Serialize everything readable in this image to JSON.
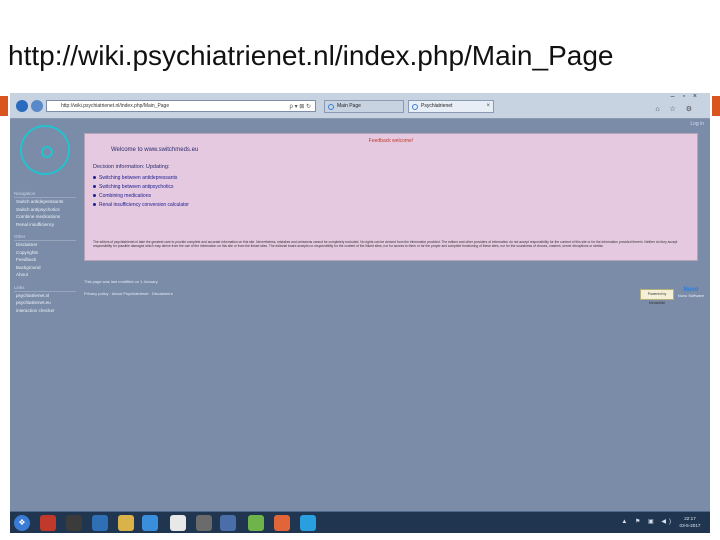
{
  "slide": {
    "title": "http://wiki.psychiatrienet.nl/index.php/Main_Page"
  },
  "browser": {
    "address": "http://wiki.psychiatrienet.nl/index.php/Main_Page",
    "address_controls": "ρ ▾ ⊠ ↻",
    "tabs": [
      {
        "label": "Main Page"
      },
      {
        "label": "Psychiatrienet"
      }
    ],
    "tab_close": "×",
    "window_controls": "– ▫ ×",
    "toolbar_icons": "⌂ ☆ ⚙",
    "login": "Log in"
  },
  "sidebar": {
    "sections": [
      {
        "heading": "Navigation",
        "items": [
          "Switch antidepressants",
          "Switch antipsychotics",
          "Combine medications",
          "Renal insufficiency"
        ]
      },
      {
        "heading": "Other",
        "items": [
          "Disclaimer",
          "Copyrights",
          "Feedback",
          "Background",
          "About"
        ]
      },
      {
        "heading": "Links",
        "items": [
          "psychiatrienet.nl",
          "psychiatrienet.eu",
          "interaction checker"
        ]
      }
    ]
  },
  "content": {
    "notice": "Feedback welcome!",
    "welcome": "Welcome to www.switchmeds.eu",
    "description_title": "Decision information: Updating:",
    "links": [
      "Switching between antidepressants",
      "Switching between antipsychotics",
      "Combining medications",
      "Renal insufficiency conversion calculator"
    ],
    "disclaimer": "The editors of psychiatrienet.nl take the greatest care to provide complete and accurate information on this site. Nevertheless, mistakes and omissions cannot be completely excluded. No rights can be derived from the information provided. The editors and other providers of information do not accept responsibility for the content of this site or for the information provided therein. Neither do they accept responsibility for possible damages which may derive from the use of the information on this site or from the linked sites. The editorial board accepts no responsibility for the content of the linked sites, nor for access to them or for the proper and complete functioning of these sites, nor for the soundness of viruses, crashes, server disruptions or similar."
  },
  "footer": {
    "modified": "This page was last modified on 1 January.",
    "links": "Privacy policy · About Psychiatrienet · Disclaimers",
    "badge_mediawiki": "Powered by MediaWiki",
    "badge_semantic_top": "Nuvo",
    "badge_semantic": "Nuvo Software"
  },
  "taskbar": {
    "start": "❖",
    "tray": "▲ ⚑ ▣ ◀)",
    "time": "22:17",
    "date": "03-5-2017"
  },
  "colors": {
    "screen_background": "#7a8ca8",
    "content_background": "#e4c9e0",
    "logo": "#22c3cf",
    "accent": "#d9541e",
    "taskbar": "#1f3550"
  }
}
